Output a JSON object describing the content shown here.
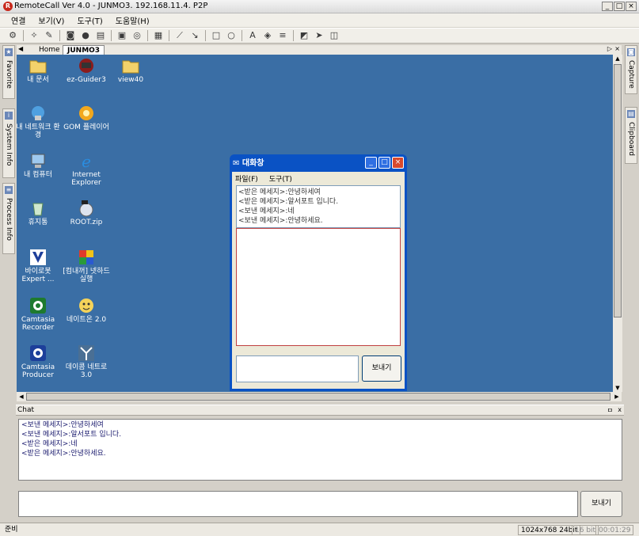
{
  "window": {
    "title": "RemoteCall Ver 4.0 - JUNMO3. 192.168.11.4. P2P",
    "app_icon": "remotecall-logo",
    "buttons": {
      "minimize": "_",
      "maximize": "□",
      "close": "×"
    }
  },
  "menu": [
    "연결",
    "보기(V)",
    "도구(T)",
    "도움말(H)"
  ],
  "toolbar": [
    "connect-icon",
    "settings-icon",
    "pen-icon",
    "camera-icon",
    "record-icon",
    "printer-icon",
    "drive-icon",
    "lock-icon",
    "grid-icon",
    "line-icon",
    "arrow-icon",
    "rectangle-icon",
    "ellipse-icon",
    "text-icon",
    "fill-icon",
    "line-width-icon",
    "eraser-icon",
    "pointer-icon",
    "screen-icon"
  ],
  "left_tabs": [
    "Favorite",
    "System Info",
    "Process Info"
  ],
  "right_tabs": [
    "Capture",
    "Clipboard"
  ],
  "tabs": {
    "home": "Home",
    "active": "JUNMO3"
  },
  "desktop_icons": [
    {
      "label": "내 문서",
      "icon": "folder-icon"
    },
    {
      "label": "ez-Guider3",
      "icon": "ezguider-icon"
    },
    {
      "label": "view40",
      "icon": "folder-icon"
    },
    {
      "label": "내 네트워크 환경",
      "icon": "network-icon"
    },
    {
      "label": "GOM 플레이어",
      "icon": "gom-icon"
    },
    {
      "label": "내 컴퓨터",
      "icon": "computer-icon"
    },
    {
      "label": "Internet Explorer",
      "icon": "ie-icon"
    },
    {
      "label": "휴지통",
      "icon": "recycle-bin-icon"
    },
    {
      "label": "ROOT.zip",
      "icon": "zip-icon"
    },
    {
      "label": "바이로봇 Expert ...",
      "icon": "virobot-icon"
    },
    {
      "label": "[컴내꺼] 넷하드실행",
      "icon": "nethard-icon"
    },
    {
      "label": "Camtasia Recorder",
      "icon": "camtasia-recorder-icon"
    },
    {
      "label": "네이트온 2.0",
      "icon": "nateon-icon"
    },
    {
      "label": "Camtasia Producer",
      "icon": "camtasia-producer-icon"
    },
    {
      "label": "데이콤 네트로 3.0",
      "icon": "dacom-icon"
    }
  ],
  "dialog": {
    "title": "대화창",
    "menu": [
      "파일(F)",
      "도구(T)"
    ],
    "messages": [
      "<받은 메세지>:안녕하세여",
      "<받은 메세지>:알서포트 입니다.",
      "<보낸 메세지>:네",
      "<보낸 메세지>:안녕하세요."
    ],
    "send_label": "보내기"
  },
  "chat": {
    "title": "Chat",
    "pin": "ㅁ",
    "close": "x",
    "messages": [
      "<보낸 메세지>:안녕하세여",
      "<보낸 메세지>:알서포트 입니다.",
      "<받은 메세지>:네",
      "<받은 메세지>:안녕하세요."
    ],
    "send_label": "보내기"
  },
  "status": {
    "text": "준비",
    "resolution": "1024x768 24bit",
    "bits": "16 bit",
    "time": "00:01:29"
  }
}
